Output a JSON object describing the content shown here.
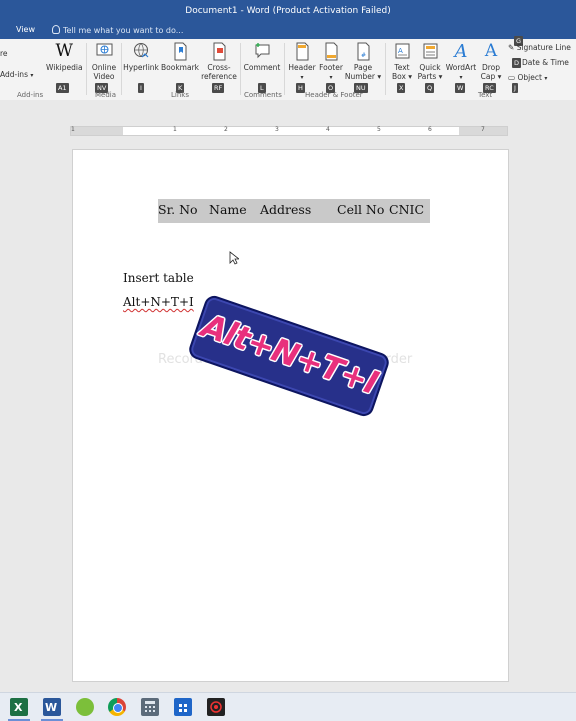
{
  "window": {
    "title": "Document1 - Word (Product Activation Failed)"
  },
  "tabs": {
    "view": "View",
    "tell_me": "Tell me what you want to do..."
  },
  "ribbon": {
    "addins_get": "re",
    "addins_my": "Add-ins",
    "wikipedia": "Wikipedia",
    "online_video_1": "Online",
    "online_video_2": "Video",
    "hyperlink": "Hyperlink",
    "bookmark": "Bookmark",
    "cross_ref_1": "Cross-",
    "cross_ref_2": "reference",
    "comment": "Comment",
    "header": "Header",
    "footer": "Footer",
    "page_number_1": "Page",
    "page_number_2": "Number",
    "text_box_1": "Text",
    "text_box_2": "Box",
    "quick_parts_1": "Quick",
    "quick_parts_2": "Parts",
    "wordart": "WordArt",
    "drop_cap_1": "Drop",
    "drop_cap_2": "Cap",
    "signature_line": "Signature Line",
    "date_time": "Date & Time",
    "object": "Object",
    "groups": {
      "addins": "Add-ins",
      "media": "Media",
      "links": "Links",
      "comments": "Comments",
      "header_footer": "Header & Footer",
      "text": "Text"
    },
    "keytips": {
      "a1": "A1",
      "nv": "NV",
      "i": "I",
      "k": "K",
      "rf": "RF",
      "l": "L",
      "h": "H",
      "o": "O",
      "nu": "NU",
      "x": "X",
      "q": "Q",
      "w": "W",
      "rc": "RC",
      "j": "J",
      "g": "G",
      "d": "D"
    }
  },
  "ruler": {
    "marks": [
      "1",
      "1",
      "2",
      "3",
      "4",
      "5",
      "6",
      "7"
    ]
  },
  "document": {
    "table_headers": [
      "Sr. No",
      "Name",
      "Address",
      "Cell No",
      "CNIC"
    ],
    "line1": "Insert table",
    "line2": "Alt+N+T+I",
    "watermark_left": "Recordo",
    "watermark_right": "Recorder"
  },
  "overlay": {
    "shortcut_badge": "Alt+N+T+I"
  },
  "colors": {
    "accent": "#2b579a",
    "badge_bg": "#27308a",
    "badge_text": "#e8307d"
  },
  "taskbar": {
    "icons": [
      "excel-icon",
      "word-icon",
      "app-green-icon",
      "chrome-icon",
      "calculator-icon",
      "store-icon",
      "recorder-icon"
    ]
  }
}
